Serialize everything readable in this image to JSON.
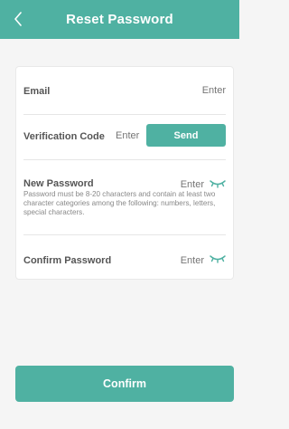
{
  "header": {
    "title": "Reset Password",
    "back_icon": "chevron-left-icon"
  },
  "form": {
    "email": {
      "label": "Email",
      "placeholder": "Enter"
    },
    "verification": {
      "label": "Verification Code",
      "placeholder": "Enter",
      "send_label": "Send"
    },
    "new_password": {
      "label": "New Password",
      "placeholder": "Enter",
      "hint": "Password must be 8-20 characters and contain at least two character categories among the following: numbers, letters, special characters.",
      "eye_icon": "eye-closed-icon"
    },
    "confirm_password": {
      "label": "Confirm Password",
      "placeholder": "Enter",
      "eye_icon": "eye-closed-icon"
    }
  },
  "confirm_button": {
    "label": "Confirm"
  },
  "colors": {
    "accent": "#4fb1a2",
    "background": "#f5f5f5"
  }
}
